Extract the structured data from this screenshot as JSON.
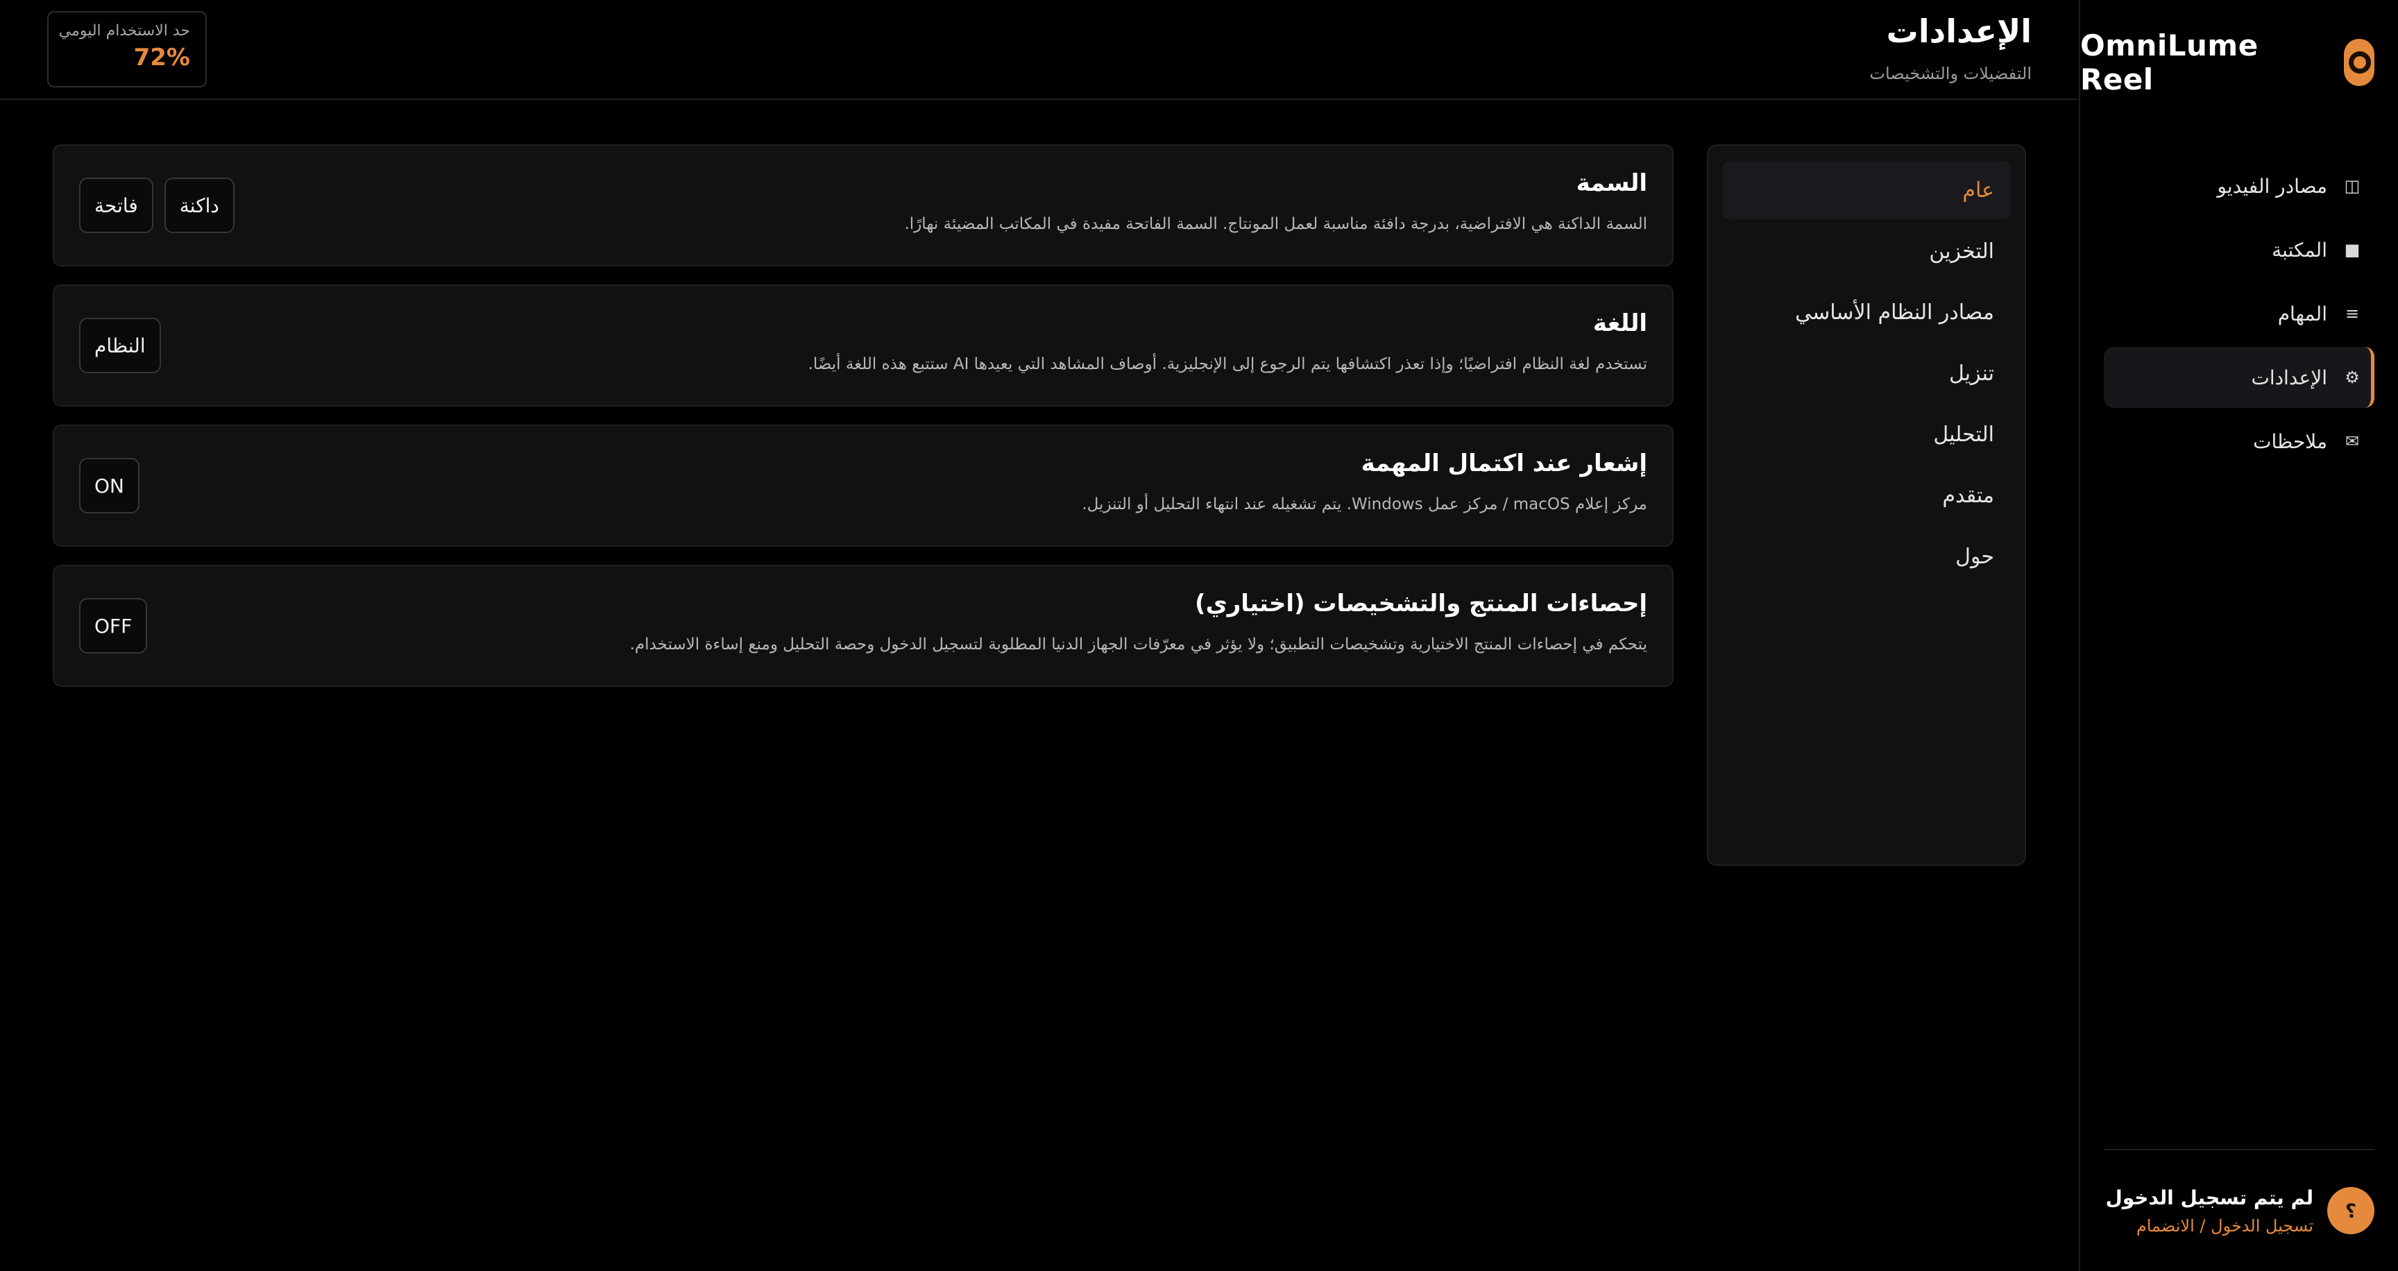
{
  "app": {
    "name": "OmniLume Reel"
  },
  "nav": {
    "items": [
      {
        "label": "مصادر الفيديو",
        "icon": "◫"
      },
      {
        "label": "المكتبة",
        "icon": "■"
      },
      {
        "label": "المهام",
        "icon": "≡"
      },
      {
        "label": "الإعدادات",
        "icon": "⚙"
      },
      {
        "label": "ملاحظات",
        "icon": "✉"
      }
    ],
    "active_index": 3
  },
  "account": {
    "avatar": "؟",
    "status": "لم يتم تسجيل الدخول",
    "link": "تسجيل الدخول / الانضمام"
  },
  "header": {
    "title": "الإعدادات",
    "subtitle": "التفضيلات والتشخيصات",
    "usage_label": "حد الاستخدام اليومي",
    "usage_value": "72%"
  },
  "categories": {
    "items": [
      "عام",
      "التخزين",
      "مصادر النظام الأساسي",
      "تنزيل",
      "التحليل",
      "متقدم",
      "حول"
    ],
    "active_index": 0
  },
  "settings": {
    "theme": {
      "title": "السمة",
      "description": "السمة الداكنة هي الافتراضية، بدرجة دافئة مناسبة لعمل المونتاج. السمة الفاتحة مفيدة في المكاتب المضيئة نهارًا.",
      "option_dark": "داكنة",
      "option_light": "فاتحة"
    },
    "language": {
      "title": "اللغة",
      "description": "تستخدم لغة النظام افتراضيًا؛ وإذا تعذر اكتشافها يتم الرجوع إلى الإنجليزية. أوصاف المشاهد التي يعيدها AI ستتبع هذه اللغة أيضًا.",
      "value": "النظام"
    },
    "notify": {
      "title": "إشعار عند اكتمال المهمة",
      "description": "مركز إعلام macOS / مركز عمل Windows. يتم تشغيله عند انتهاء التحليل أو التنزيل.",
      "value": "ON"
    },
    "telemetry": {
      "title": "إحصاءات المنتج والتشخيصات (اختياري)",
      "description": "يتحكم في إحصاءات المنتج الاختيارية وتشخيصات التطبيق؛ ولا يؤثر في معرّفات الجهاز الدنيا المطلوبة لتسجيل الدخول وحصة التحليل ومنع إساءة الاستخدام.",
      "value": "OFF"
    }
  },
  "colors": {
    "accent": "#e58a3c",
    "background": "#000000",
    "panel": "#111114"
  }
}
